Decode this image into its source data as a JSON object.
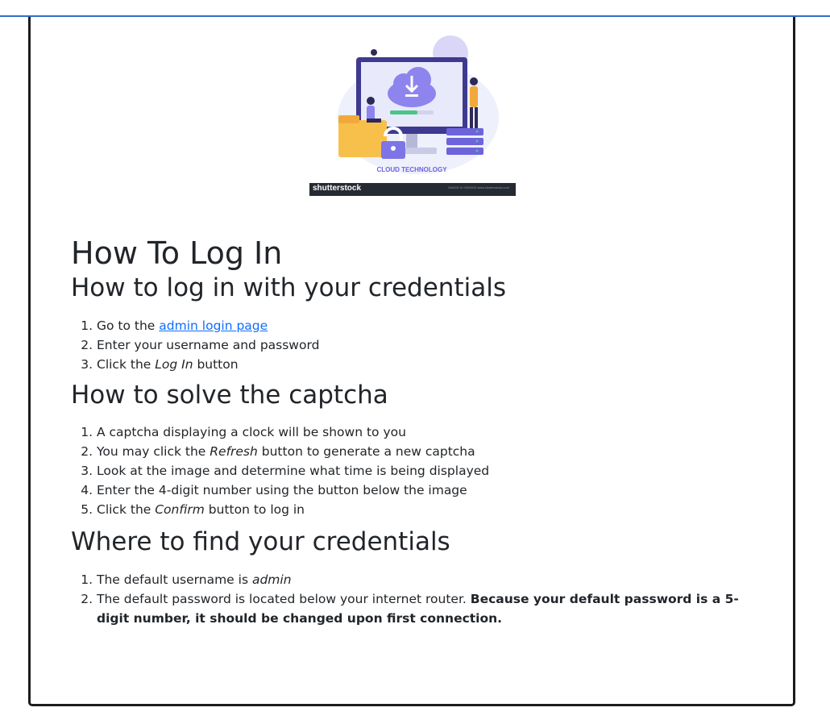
{
  "hero_image": {
    "caption": "CLOUD TECHNOLOGY",
    "watermark_brand": "shutterstock",
    "watermark_meta": "IMAGE ID 0000000 www.shutterstock.com",
    "colors": {
      "screen": "#5b4fd1",
      "cloud": "#8e84ee",
      "folder": "#f7c04a",
      "lock": "#7d74e6",
      "server": "#6d63dd",
      "accent": "#4cc48a"
    }
  },
  "page": {
    "title": "How To Log In",
    "sections": {
      "credentials": {
        "heading": "How to log in with your credentials",
        "steps": {
          "step1_prefix": "Go to the ",
          "step1_link": "admin login page",
          "step2": "Enter your username and password",
          "step3_prefix": "Click the ",
          "step3_em": "Log In",
          "step3_suffix": " button"
        }
      },
      "captcha": {
        "heading": "How to solve the captcha",
        "steps": {
          "step1": "A captcha displaying a clock will be shown to you",
          "step2_prefix": "You may click the ",
          "step2_em": "Refresh",
          "step2_suffix": " button to generate a new captcha",
          "step3": "Look at the image and determine what time is being displayed",
          "step4": "Enter the 4-digit number using the button below the image",
          "step5_prefix": "Click the ",
          "step5_em": "Confirm",
          "step5_suffix": " button to log in"
        }
      },
      "find_credentials": {
        "heading": "Where to find your credentials",
        "steps": {
          "step1_prefix": "The default username is ",
          "step1_em": "admin",
          "step2_prefix": "The default password is located below your internet router. ",
          "step2_bold": "Because your default password is a 5-digit number, it should be changed upon first connection."
        }
      }
    }
  }
}
